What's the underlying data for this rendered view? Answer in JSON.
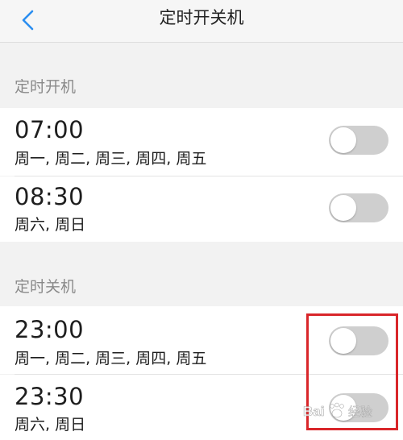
{
  "header": {
    "title": "定时开关机"
  },
  "sections": [
    {
      "title": "定时开机",
      "items": [
        {
          "time": "07:00",
          "days": "周一, 周二, 周三, 周四, 周五",
          "enabled": false
        },
        {
          "time": "08:30",
          "days": "周六, 周日",
          "enabled": false
        }
      ]
    },
    {
      "title": "定时关机",
      "items": [
        {
          "time": "23:00",
          "days": "周一, 周二, 周三, 周四, 周五",
          "enabled": false
        },
        {
          "time": "23:30",
          "days": "周六, 周日",
          "enabled": false
        }
      ]
    }
  ],
  "watermark": "Baidu 经验",
  "colors": {
    "accent": "#2b8ef0",
    "toggle_off": "#cfcfcf",
    "highlight": "#d9262a"
  }
}
